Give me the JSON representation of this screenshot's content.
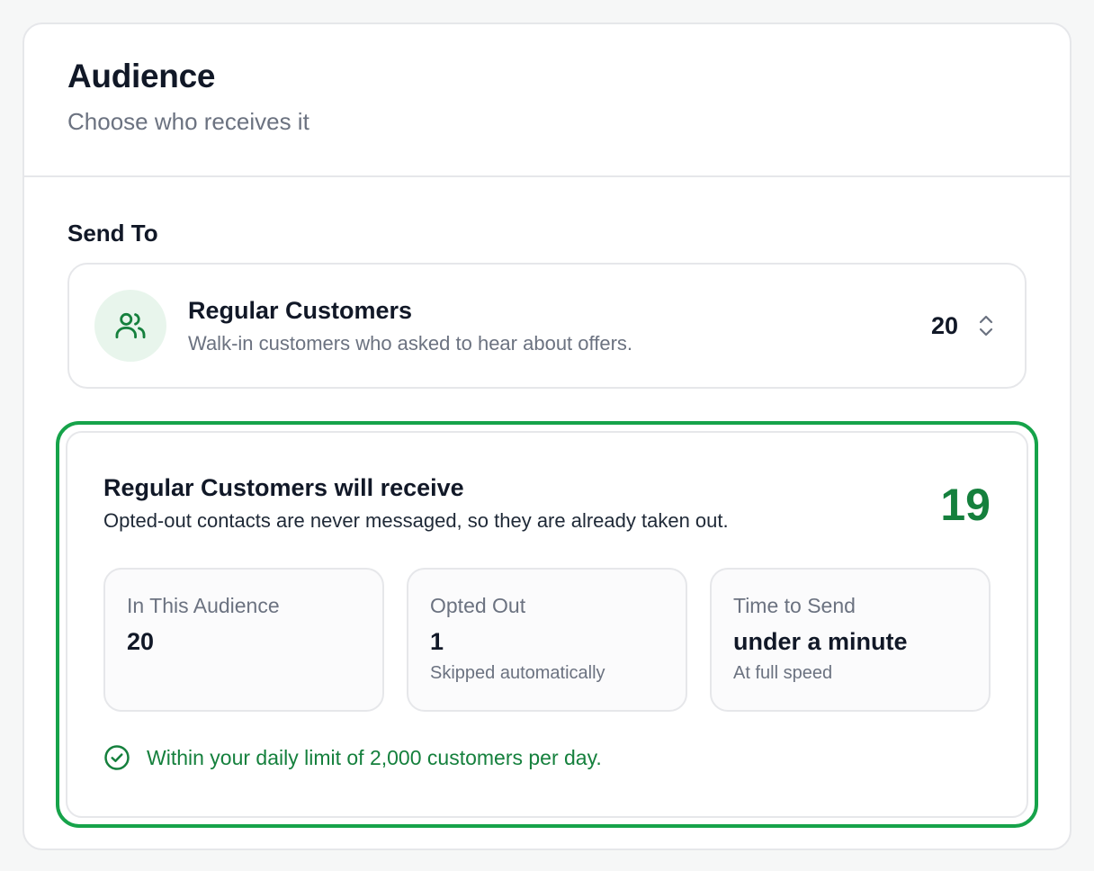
{
  "header": {
    "title": "Audience",
    "subtitle": "Choose who receives it"
  },
  "send_to": {
    "label": "Send To",
    "selected": {
      "icon": "users-icon",
      "name": "Regular Customers",
      "description": "Walk-in customers who asked to hear about offers.",
      "count": "20"
    }
  },
  "summary": {
    "title": "Regular Customers will receive",
    "note": "Opted-out contacts are never messaged, so they are already taken out.",
    "total": "19",
    "stats": [
      {
        "label": "In This Audience",
        "value": "20",
        "sub": ""
      },
      {
        "label": "Opted Out",
        "value": "1",
        "sub": "Skipped automatically"
      },
      {
        "label": "Time to Send",
        "value": "under a minute",
        "sub": "At full speed"
      }
    ],
    "limit_icon": "check-circle-icon",
    "limit_text": "Within your daily limit of 2,000 customers per day."
  },
  "colors": {
    "accent_green": "#16a34a",
    "text_green": "#15803d",
    "avatar_bg": "#e8f5ec"
  }
}
